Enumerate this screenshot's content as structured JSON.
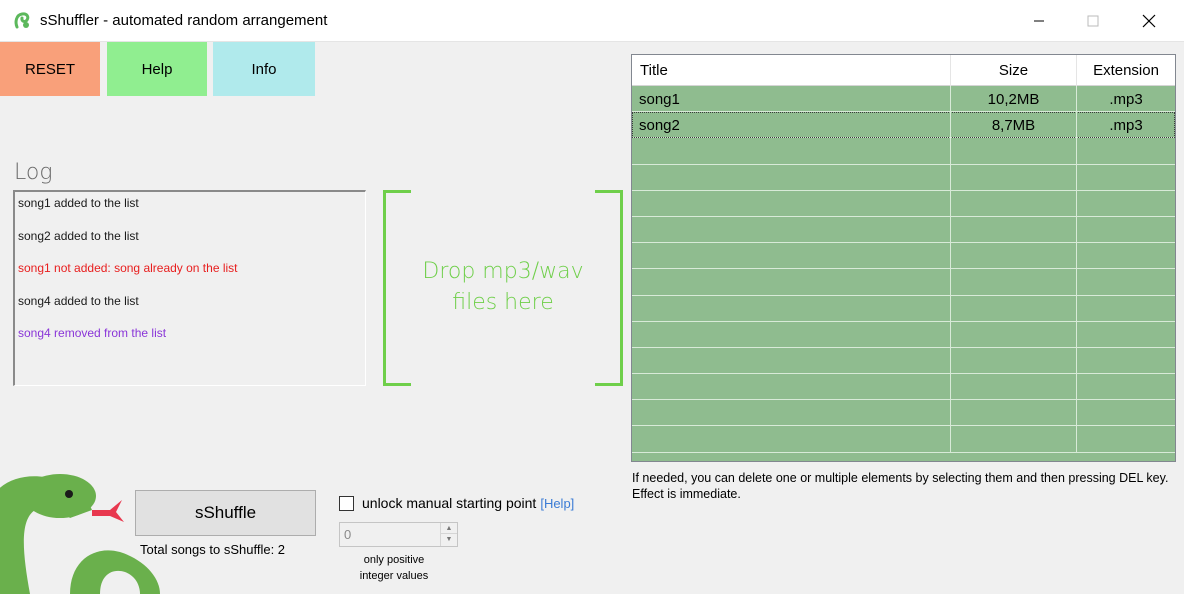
{
  "window": {
    "title": "sShuffler - automated random arrangement"
  },
  "toolbar": {
    "reset_label": "RESET",
    "help_label": "Help",
    "info_label": "Info"
  },
  "log": {
    "title": "Log",
    "entries": [
      {
        "text": "song1 added to the list",
        "color": "#1a1a1a"
      },
      {
        "text": "song2 added to the list",
        "color": "#1a1a1a"
      },
      {
        "text": "song1 not added: song already on the list",
        "color": "#e81e1e"
      },
      {
        "text": "song4 added to the list",
        "color": "#1a1a1a"
      },
      {
        "text": "song4 removed from the list",
        "color": "#8a35d8"
      }
    ]
  },
  "dropzone": {
    "line1": "Drop mp3/wav",
    "line2": "files here"
  },
  "table": {
    "columns": [
      "Title",
      "Size",
      "Extension"
    ],
    "rows": [
      {
        "title": "song1",
        "size": "10,2MB",
        "ext": ".mp3"
      },
      {
        "title": "song2",
        "size": "8,7MB",
        "ext": ".mp3"
      }
    ],
    "hint": "If needed, you can delete one or multiple elements by selecting them and then pressing DEL key. Effect is immediate."
  },
  "shuffle": {
    "button_label": "sShuffle",
    "total_label": "Total songs to sShuffle: 2"
  },
  "manual_start": {
    "checkbox_label": "unlock manual starting point",
    "help_link": "[Help]",
    "value": "0",
    "note_line1": "only positive",
    "note_line2": "integer values"
  },
  "colors": {
    "reset": "#f9a07a",
    "help": "#90ee90",
    "info": "#b0eaec",
    "table_bg": "#8fbc8f",
    "dropzone": "#6fcf4a"
  }
}
